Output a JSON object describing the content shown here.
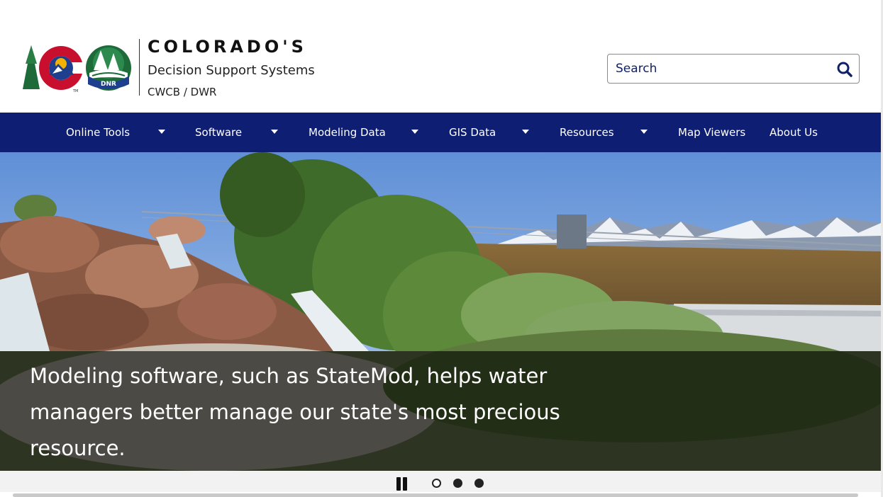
{
  "header": {
    "brand_title": "COLORADO'S",
    "brand_subtitle": "Decision Support Systems",
    "brand_agency": "CWCB / DWR",
    "dnr_logo_text": "DNR",
    "co_logo_tm": "TM",
    "search_placeholder": "Search"
  },
  "nav": {
    "items": [
      {
        "label": "Online Tools",
        "has_dropdown": true
      },
      {
        "label": "Software",
        "has_dropdown": true
      },
      {
        "label": "Modeling Data",
        "has_dropdown": true
      },
      {
        "label": "GIS Data",
        "has_dropdown": true
      },
      {
        "label": "Resources",
        "has_dropdown": true
      },
      {
        "label": "Map Viewers",
        "has_dropdown": false
      },
      {
        "label": "About Us",
        "has_dropdown": false
      }
    ]
  },
  "hero": {
    "caption": "Modeling software, such as StateMod, helps water managers better manage our state's most precious resource.",
    "slide_count": 3,
    "active_slide": 1
  },
  "icons": {
    "search": "search-icon",
    "caret": "caret-down-icon",
    "pause": "pause-icon"
  },
  "colors": {
    "nav_background": "#0d1e73",
    "search_text": "#102167",
    "logo_red": "#c8102e",
    "logo_blue": "#1d3f8e",
    "logo_gold": "#f2b300",
    "dnr_green": "#1e6b3a"
  }
}
